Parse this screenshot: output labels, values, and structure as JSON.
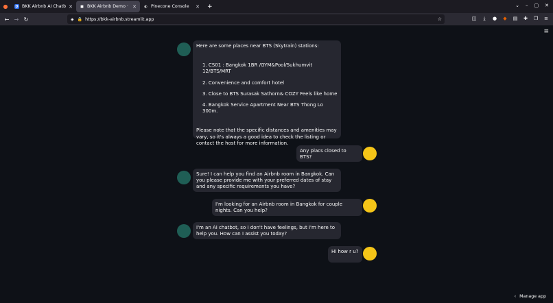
{
  "browser": {
    "tabs": [
      {
        "title": "BKK Airbnb AI Chatbot | S",
        "icon": "D"
      },
      {
        "title": "BKK Airbnb Demo · Strea",
        "icon": "■"
      },
      {
        "title": "Pinecone Console",
        "icon": "◐"
      }
    ],
    "new_tab": "+",
    "url": "https://bkk-airbnb.streamlit.app"
  },
  "chat": {
    "messages": [
      {
        "role": "assistant",
        "intro": "Here are some places near BTS (Skytrain) stations:",
        "items": [
          "1. CS01 : Bangkok 1BR /GYM&Pool/Sukhumvit 12/BTS/MRT",
          "2. Convenience and comfort hotel",
          "3. Close to BTS Surasak Sathorn& COZY Feels like home",
          "4. Bangkok Service Apartment Near BTS Thong Lo 300m."
        ],
        "outro": "Please note that the specific distances and amenities may vary, so it's always a good idea to check the listing or contact the host for more information."
      },
      {
        "role": "user",
        "text": "Any placs closed to BTS?"
      },
      {
        "role": "assistant",
        "text": "Sure! I can help you find an Airbnb room in Bangkok. Can you please provide me with your preferred dates of stay and any specific requirements you have?"
      },
      {
        "role": "user",
        "text": "I'm looking for an Airbnb room in Bangkok for couple nights. Can you help?"
      },
      {
        "role": "assistant",
        "text": "I'm an AI chatbot, so I don't have feelings, but I'm here to help you. How can I assist you today?"
      },
      {
        "role": "user",
        "text": "Hi how r u?"
      }
    ]
  },
  "footer": {
    "manage_label": "Manage app"
  },
  "colors": {
    "app_bg": "#0e1117",
    "bubble_bg": "#262730",
    "bot_avatar": "#1f5e55",
    "user_avatar": "#f5c518"
  }
}
